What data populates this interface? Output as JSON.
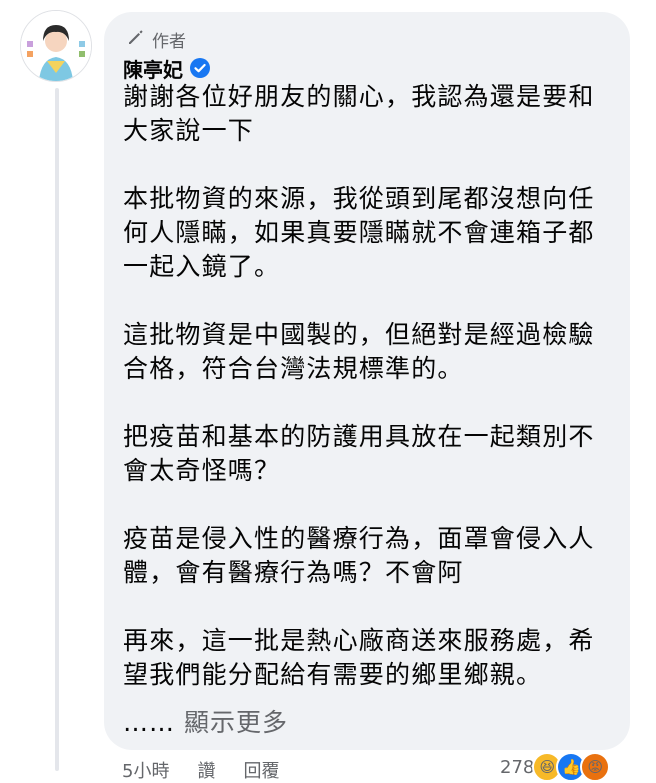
{
  "comment": {
    "author_badge": "作者",
    "author_name": "陳亭妃",
    "paragraphs": [
      "謝謝各位好朋友的關心，我認為還是要和大家說一下",
      "本批物資的來源，我從頭到尾都沒想向任何人隱瞞，如果真要隱瞞就不會連箱子都一起入鏡了。",
      "這批物資是中國製的，但絕對是經過檢驗合格，符合台灣法規標準的。",
      "把疫苗和基本的防護用具放在一起類別不會太奇怪嗎？",
      "疫苗是侵入性的醫療行為，面罩會侵入人體，會有醫療行為嗎？不會阿",
      "再來，這一批是熱心廠商送來服務處，希望我們能分配給有需要的鄉里鄉親。"
    ],
    "see_more_dots": "……",
    "see_more_label": "顯示更多",
    "time": "5小時",
    "like_label": "讚",
    "reply_label": "回覆",
    "reaction_count": "278"
  },
  "icons": {
    "pencil": "pencil-icon",
    "verified": "verified-badge-icon",
    "haha": "haha-reaction-icon",
    "like": "like-reaction-icon",
    "angry": "angry-reaction-icon"
  },
  "colors": {
    "bubble": "#f0f2f5",
    "verified_blue": "#1877f2",
    "muted_text": "#65676b"
  }
}
